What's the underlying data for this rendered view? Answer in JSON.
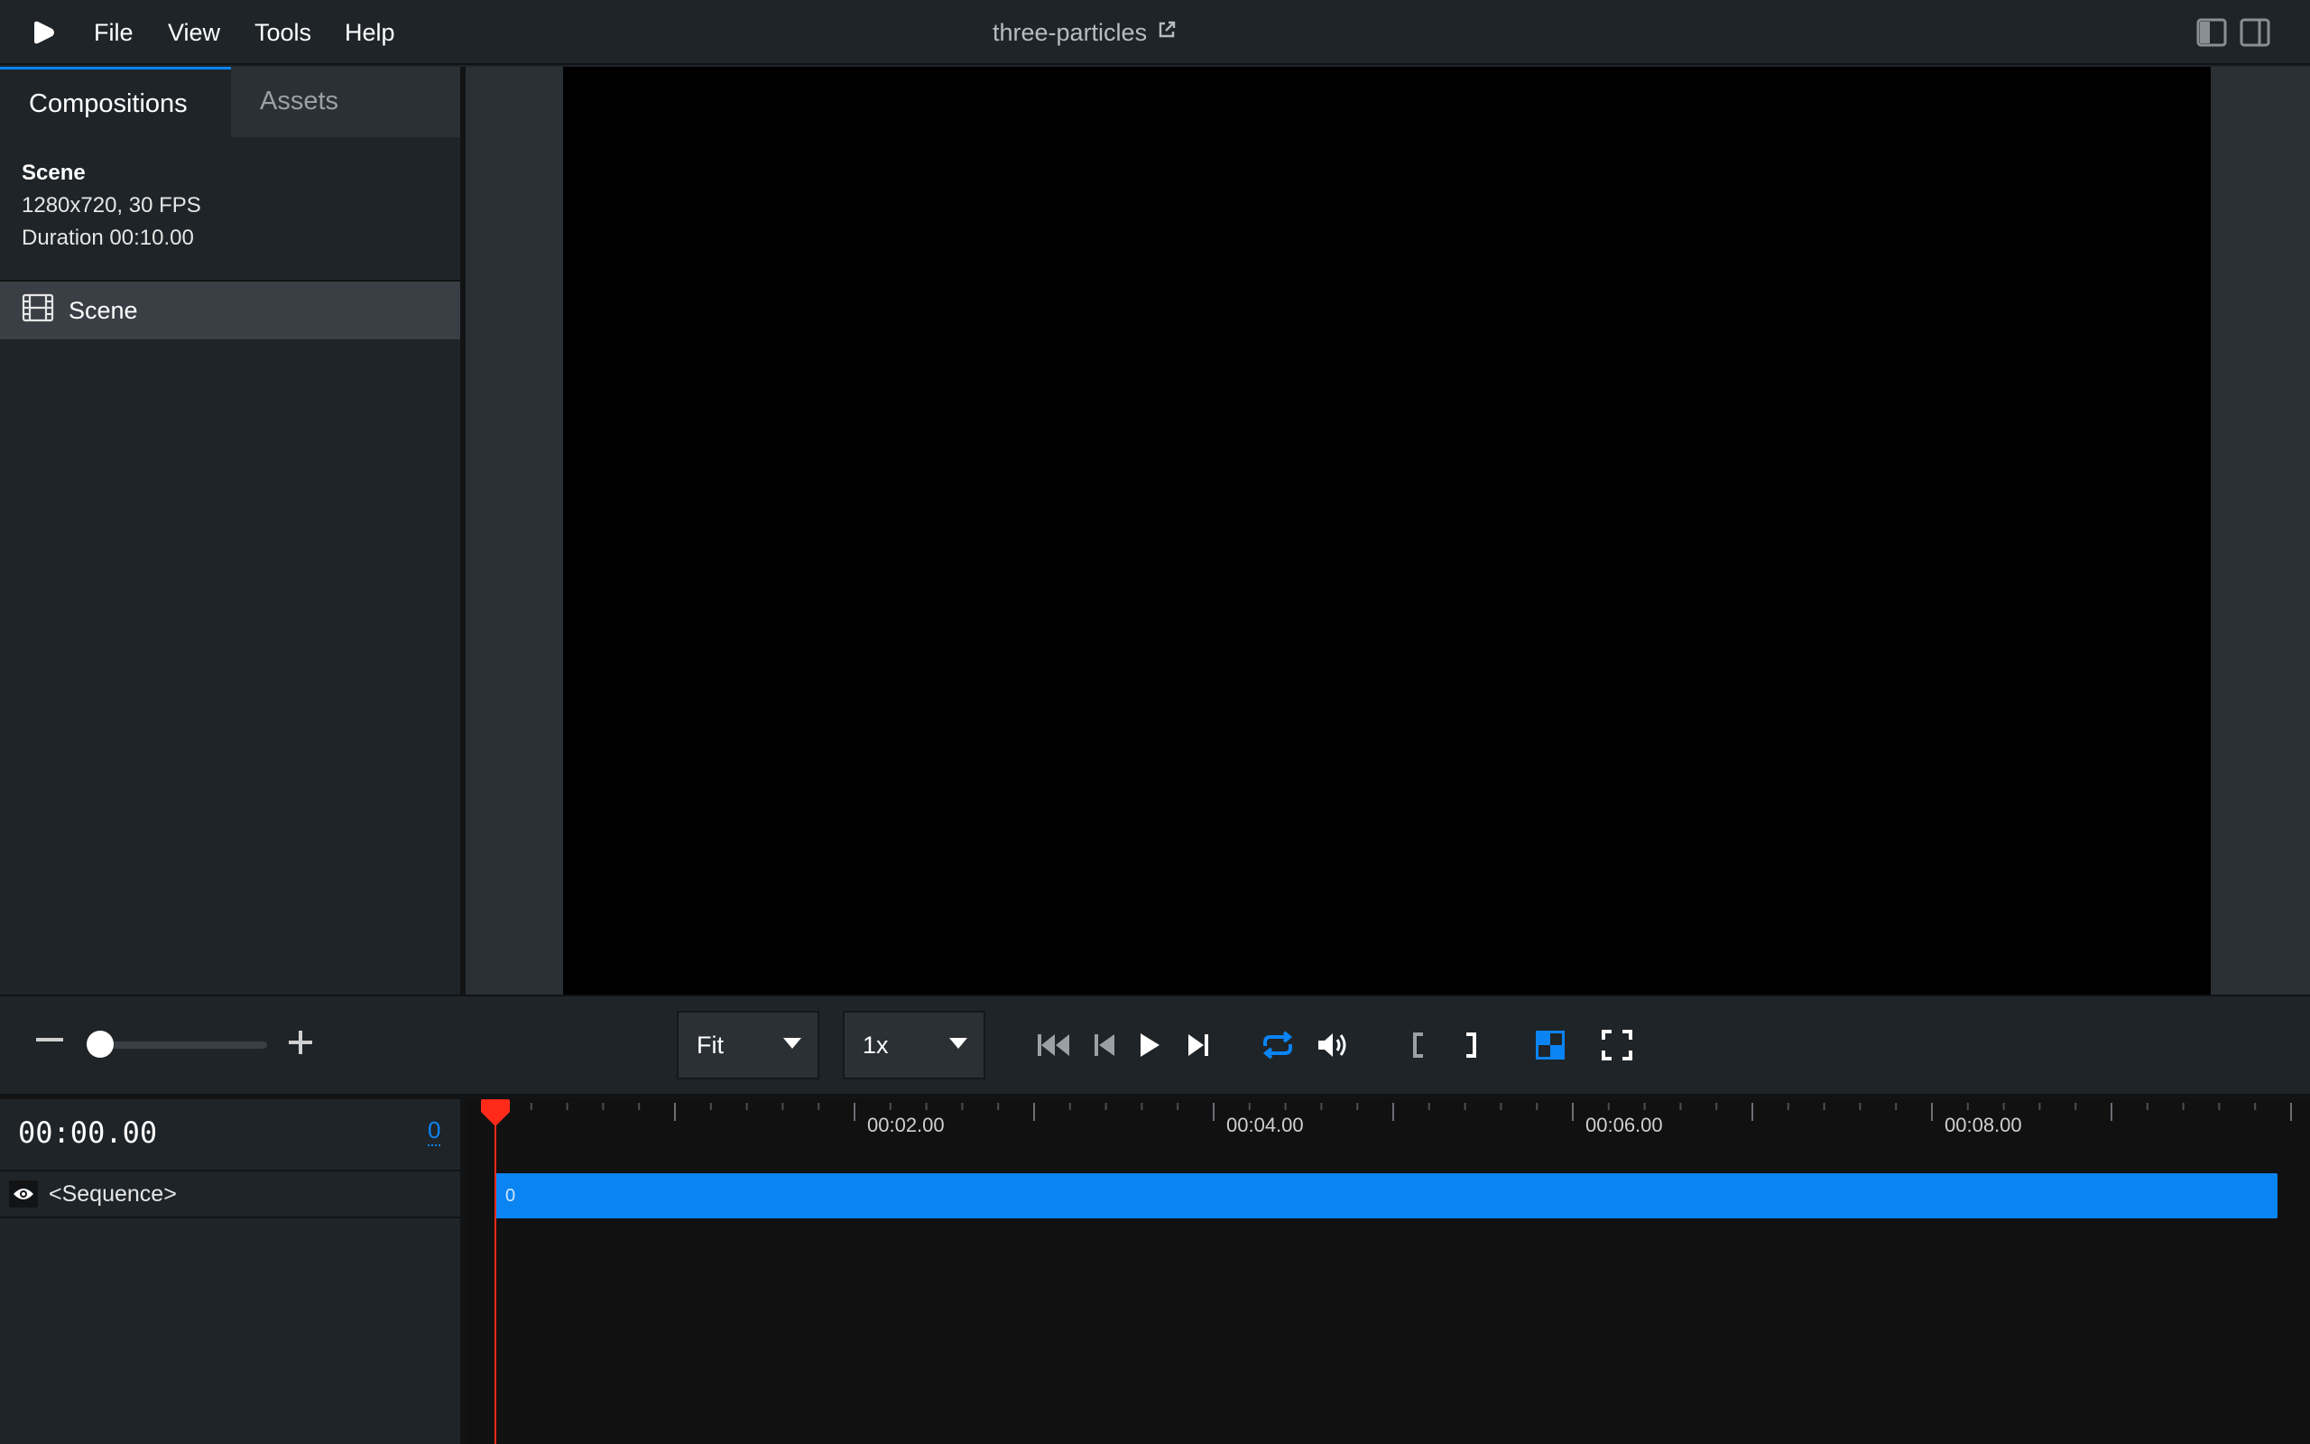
{
  "menu": {
    "items": [
      "File",
      "View",
      "Tools",
      "Help"
    ],
    "project_title": "three-particles"
  },
  "left_panel": {
    "tabs": [
      {
        "label": "Compositions",
        "active": true
      },
      {
        "label": "Assets",
        "active": false
      }
    ],
    "composition_info": {
      "name": "Scene",
      "resolution_fps": "1280x720, 30 FPS",
      "duration": "Duration 00:10.00"
    },
    "compositions": [
      {
        "label": "Scene",
        "selected": true,
        "icon": "film-icon"
      }
    ]
  },
  "controls": {
    "zoom_level": 0.0,
    "size_select": "Fit",
    "speed_select": "1x",
    "loop_enabled": true
  },
  "timeline": {
    "timecode": "00:00.00",
    "frame": "0",
    "sequence_label": "<Sequence>",
    "sequence_start_label": "0",
    "tick_labels": [
      "00:02.00",
      "00:04.00",
      "00:06.00",
      "00:08.00"
    ],
    "duration_seconds": 10,
    "playhead_seconds": 0
  },
  "colors": {
    "accent": "#0b84f3",
    "playhead": "#ff2a1a",
    "panel": "#1f2428",
    "canvas": "#000000"
  }
}
